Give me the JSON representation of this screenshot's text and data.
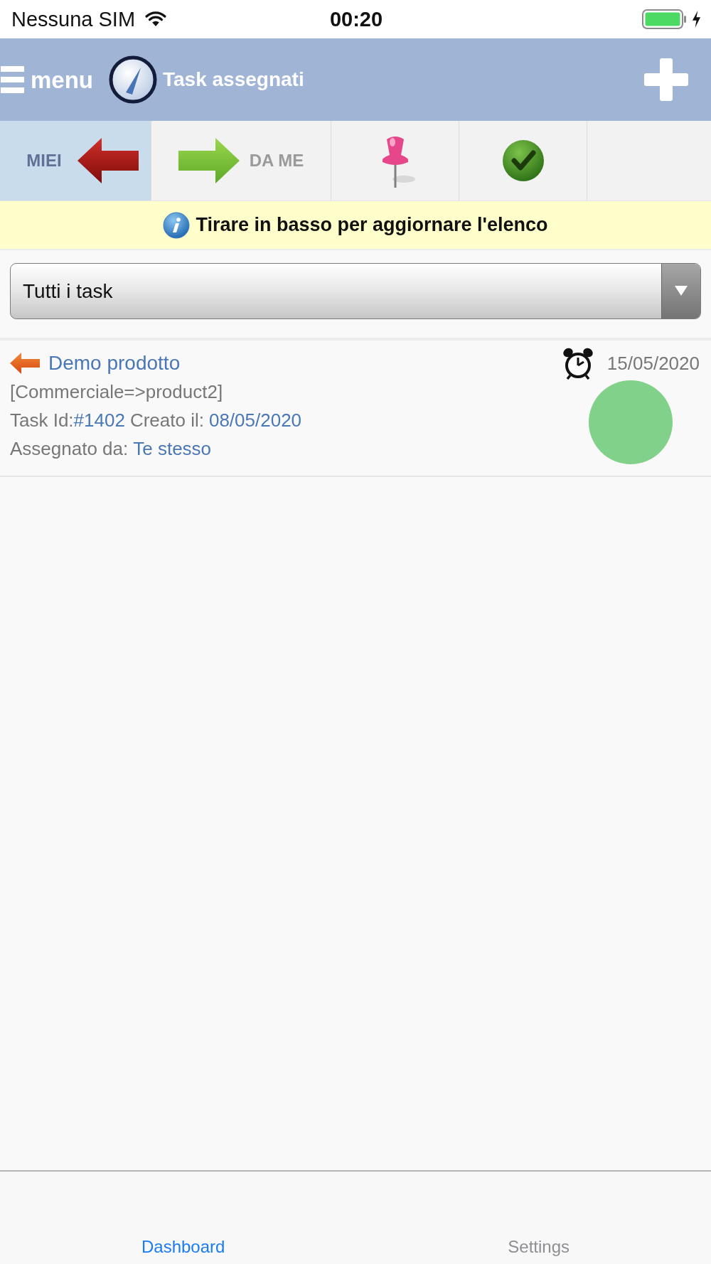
{
  "status_bar": {
    "carrier": "Nessuna SIM",
    "time": "00:20"
  },
  "header": {
    "menu_label": "menu",
    "title": "Task assegnati"
  },
  "tabs": [
    {
      "kind": "incoming",
      "label": "MIEI",
      "selected": true
    },
    {
      "kind": "outgoing",
      "label": "DA ME",
      "selected": false
    },
    {
      "kind": "pinned",
      "selected": false
    },
    {
      "kind": "completed",
      "selected": false
    }
  ],
  "info_bar": {
    "text": "Tirare in basso per aggiornare l'elenco"
  },
  "filter": {
    "value": "Tutti i task"
  },
  "tasks": [
    {
      "title": "Demo prodotto",
      "category": "[Commerciale=>product2]",
      "id_label": "Task Id:",
      "id": "#1402",
      "created_label": "Creato il:",
      "created": "08/05/2020",
      "assigned_label": "Assegnato da:",
      "assigned_by": "Te stesso",
      "due_date": "15/05/2020",
      "color": "#82d18a"
    }
  ],
  "bottom_tabs": [
    {
      "label": "Dashboard",
      "selected": true
    },
    {
      "label": "Settings",
      "selected": false
    }
  ]
}
